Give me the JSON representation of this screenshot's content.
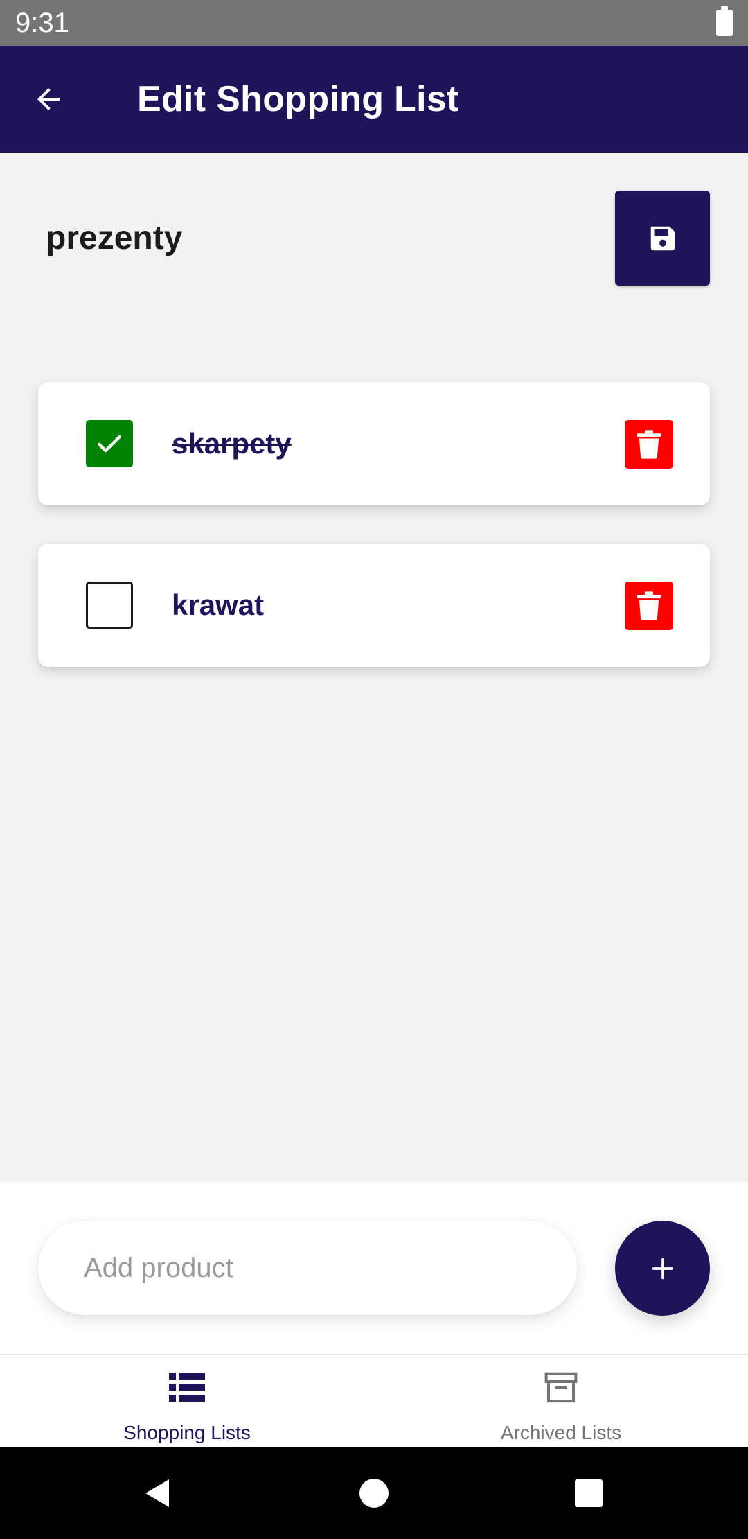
{
  "status_bar": {
    "time": "9:31"
  },
  "app_bar": {
    "title": "Edit Shopping List",
    "back_icon": "arrow-left-icon"
  },
  "list": {
    "name": "prezenty",
    "save_icon": "floppy-disk-icon"
  },
  "items": [
    {
      "label": "skarpety",
      "checked": true
    },
    {
      "label": "krawat",
      "checked": false
    }
  ],
  "add_product": {
    "placeholder": "Add product",
    "value": ""
  },
  "bottom_nav": {
    "items": [
      {
        "label": "Shopping Lists",
        "icon": "list-icon",
        "active": true
      },
      {
        "label": "Archived Lists",
        "icon": "archive-icon",
        "active": false
      }
    ]
  },
  "colors": {
    "primary": "#1f145a",
    "checked": "#028203",
    "delete": "#ff0000",
    "background": "#f2f2f2",
    "status_bar": "#757575"
  }
}
